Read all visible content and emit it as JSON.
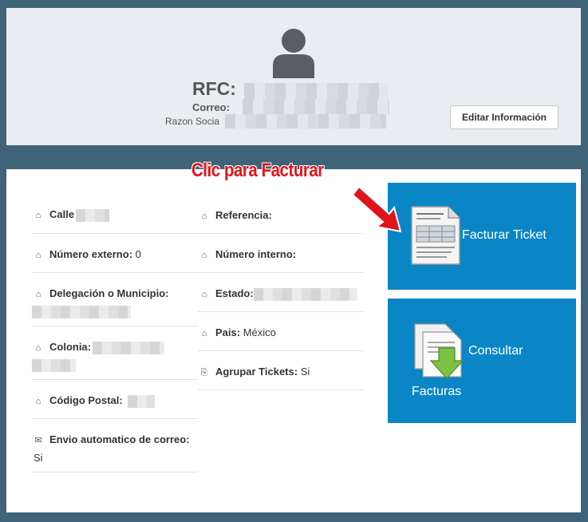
{
  "profile": {
    "rfc_label": "RFC:",
    "correo_label": "Correo:",
    "razon_label": "Razon Socia",
    "edit_button": "Editar Información"
  },
  "annotation": {
    "text": "Clic para Facturar"
  },
  "fields": {
    "calle_label": "Calle",
    "numero_externo_label": "Número externo:",
    "numero_externo_value": "0",
    "delegacion_label": "Delegación o Municipio:",
    "colonia_label": "Colonia:",
    "codigo_postal_label": "Código Postal:",
    "envio_label": "Envio automatico de correo:",
    "envio_value": "Si",
    "referencia_label": "Referencia:",
    "numero_interno_label": "Número interno:",
    "estado_label": "Estado:",
    "pais_label": "Pais:",
    "pais_value": "México",
    "agrupar_label": "Agrupar Tickets:",
    "agrupar_value": "Si"
  },
  "tiles": {
    "facturar": "Facturar Ticket",
    "consultar_1": "Consultar",
    "consultar_2": "Facturas"
  },
  "colors": {
    "background": "#3f6479",
    "tile": "#0a86c6",
    "annotation": "#e0151b"
  }
}
